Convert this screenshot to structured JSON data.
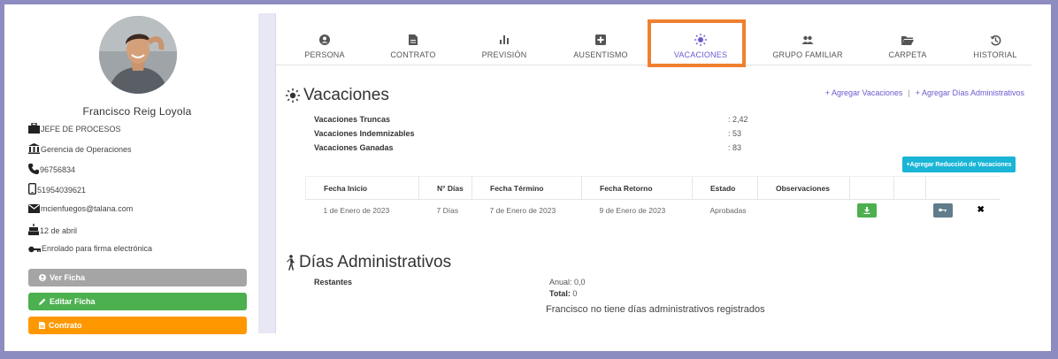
{
  "profile": {
    "name": "Francisco Reig Loyola",
    "position": "JEFE DE PROCESOS",
    "department": "Gerencia de Operaciones",
    "phone": "96756834",
    "mobile": "51954039621",
    "email": "mcienfuegos@talana.com",
    "birthday": "12 de abril",
    "signature_status": "Enrolado para firma electrónica"
  },
  "sidebar_buttons": {
    "ver_ficha": "Ver Ficha",
    "editar_ficha": "Editar Ficha",
    "contrato": "Contrato"
  },
  "tabs": [
    {
      "label": "PERSONA",
      "icon": "person-icon"
    },
    {
      "label": "CONTRATO",
      "icon": "document-icon"
    },
    {
      "label": "PREVISIÓN",
      "icon": "bar-chart-icon"
    },
    {
      "label": "AUSENTISMO",
      "icon": "medical-cross-icon"
    },
    {
      "label": "VACACIONES",
      "icon": "sun-icon",
      "active": true
    },
    {
      "label": "GRUPO FAMILIAR",
      "icon": "people-icon"
    },
    {
      "label": "CARPETA",
      "icon": "folder-icon"
    },
    {
      "label": "HISTORIAL",
      "icon": "history-icon"
    }
  ],
  "vacaciones": {
    "title": "Vacaciones",
    "links": {
      "agregar_vacaciones": "+ Agregar Vacaciones",
      "separator": "|",
      "agregar_dias_admin": "+ Agregar Días Administrativos"
    },
    "summary": [
      {
        "label": "Vacaciones Truncas",
        "value": ": 2,42"
      },
      {
        "label": "Vacaciones Indemnizables",
        "value": ": 53"
      },
      {
        "label": "Vacaciones Ganadas",
        "value": ": 83"
      }
    ],
    "reduce_button": "+Agregar Reducción de Vacaciones",
    "table": {
      "headers": [
        "Fecha Inicio",
        "N° Días",
        "Fecha Término",
        "Fecha Retorno",
        "Estado",
        "Observaciones"
      ],
      "rows": [
        {
          "inicio": "1 de Enero de 2023",
          "dias": "7 Días",
          "termino": "7 de Enero de 2023",
          "retorno": "9 de Enero de 2023",
          "estado": "Aprobadas",
          "observaciones": ""
        }
      ]
    }
  },
  "dias_admin": {
    "title": "Días Administrativos",
    "restantes_label": "Restantes",
    "anual": "Anual: 0,0",
    "total_label": "Total:",
    "total_value": "0",
    "empty_message": "Francisco no tiene días administrativos registrados"
  },
  "colors": {
    "accent": "#6a5ad0",
    "highlight": "#f08030",
    "success": "#4cb04f",
    "warning": "#ff9800",
    "info": "#1ab5d6"
  }
}
